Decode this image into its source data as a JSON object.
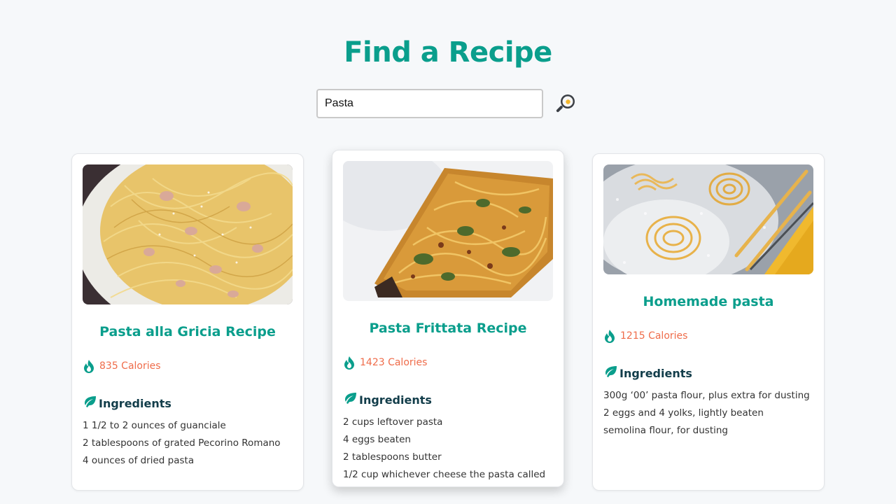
{
  "header": {
    "title": "Find a Recipe"
  },
  "search": {
    "value": "Pasta"
  },
  "recipes": [
    {
      "title": "Pasta alla Gricia Recipe",
      "calories": "835 Calories",
      "ingredients_label": "Ingredients",
      "ingredients": [
        "1 1/2 to 2 ounces of guanciale",
        "2 tablespoons of grated Pecorino Romano",
        "4 ounces of dried pasta"
      ]
    },
    {
      "title": "Pasta Frittata Recipe",
      "calories": "1423 Calories",
      "ingredients_label": "Ingredients",
      "ingredients": [
        "2 cups leftover pasta",
        "4 eggs beaten",
        "2 tablespoons butter",
        "1/2 cup whichever cheese the pasta called"
      ]
    },
    {
      "title": "Homemade pasta",
      "calories": "1215 Calories",
      "ingredients_label": "Ingredients",
      "ingredients": [
        "300g ‘00’ pasta flour, plus extra for dusting",
        "2 eggs and 4 yolks, lightly beaten",
        "semolina flour, for dusting"
      ]
    }
  ],
  "icons": [
    "frying-pan-search-icon",
    "flame-icon",
    "leaf-icon"
  ],
  "colors": {
    "accent": "#0a9e8c",
    "calories": "#ef6c4a",
    "heading": "#123d4a",
    "background": "#f6f8fa"
  }
}
